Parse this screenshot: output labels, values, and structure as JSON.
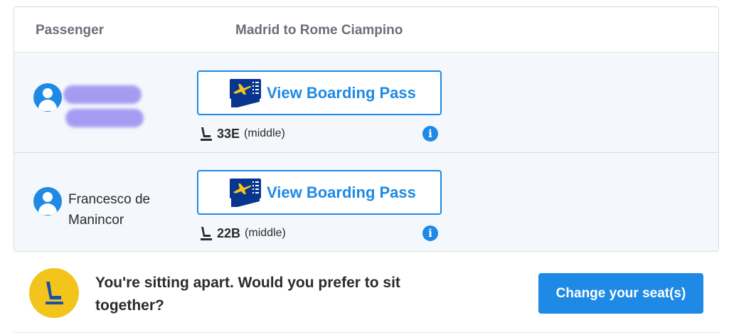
{
  "header": {
    "passenger_col": "Passenger",
    "route_col": "Madrid to Rome Ciampino"
  },
  "passengers": [
    {
      "name": "",
      "name_redacted": true,
      "boarding_pass_label": "View Boarding Pass",
      "seat": "33E",
      "seat_type": "(middle)"
    },
    {
      "name": "Francesco de Manincor",
      "name_redacted": false,
      "boarding_pass_label": "View Boarding Pass",
      "seat": "22B",
      "seat_type": "(middle)"
    }
  ],
  "notice": {
    "message": "You're sitting apart. Would you prefer to sit together?",
    "button_label": "Change your seat(s)"
  },
  "icons": {
    "avatar": "user-avatar-icon",
    "boarding_pass": "boarding-pass-icon",
    "seat": "seat-icon",
    "info": "info-icon"
  },
  "colors": {
    "accent": "#1e8ae6",
    "notice_badge": "#f2c41c",
    "row_background": "#f4f7fb",
    "boarding_pass_icon": "#073590",
    "plane_yellow": "#f2c41c"
  }
}
